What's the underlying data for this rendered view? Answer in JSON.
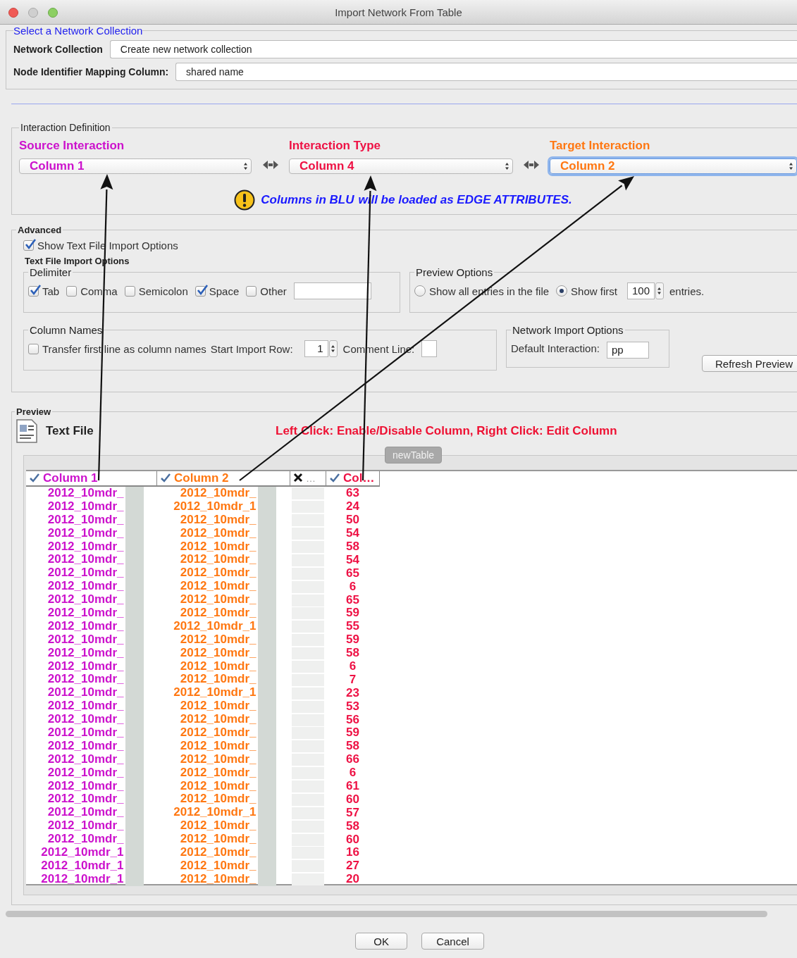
{
  "window": {
    "title": "Import Network From Table"
  },
  "network_collection": {
    "legend": "Select a Network Collection",
    "fields": [
      {
        "label": "Network Collection",
        "value": "Create new network collection"
      },
      {
        "label": "Node Identifier Mapping Column:",
        "value": "shared name"
      }
    ]
  },
  "interaction_definition": {
    "legend": "Interaction Definition",
    "selectors": [
      {
        "label": "Source Interaction",
        "value": "Column 1",
        "color": "#cc11cc",
        "focused": false
      },
      {
        "label": "Interaction Type",
        "value": "Column 4",
        "color": "#ee1144",
        "focused": false
      },
      {
        "label": "Target Interaction",
        "value": "Column 2",
        "color": "#ff7711",
        "focused": true
      }
    ],
    "notice": [
      "Columns in BLU",
      "will be loaded as EDGE ATTRIBUTES."
    ]
  },
  "advanced": {
    "legend": "Advanced",
    "show_options": {
      "label": "Show Text File Import Options",
      "checked": true
    },
    "options_title": "Text File Import Options",
    "delimiter": {
      "legend": "Delimiter",
      "items": [
        {
          "label": "Tab",
          "checked": true
        },
        {
          "label": "Comma",
          "checked": false
        },
        {
          "label": "Semicolon",
          "checked": false
        },
        {
          "label": "Space",
          "checked": true
        },
        {
          "label": "Other",
          "checked": false
        }
      ]
    },
    "preview_options": {
      "legend": "Preview Options",
      "choices": [
        {
          "label": "Show all entries in the file",
          "selected": false
        },
        {
          "label": "Show first",
          "selected": true
        }
      ],
      "count": "100",
      "suffix": "entries."
    },
    "column_names": {
      "legend": "Column Names",
      "transfer": {
        "label": "Transfer first line as column names",
        "checked": false
      },
      "start_row_label": "Start Import Row:",
      "start_row": "1",
      "comment_label": "Comment Line:"
    },
    "network_import": {
      "legend": "Network Import Options",
      "default_label": "Default Interaction:",
      "default_value": "pp"
    },
    "refresh_button": "Refresh Preview"
  },
  "preview": {
    "legend": "Preview",
    "file_label": "Text File",
    "hint": "Left Click: Enable/Disable Column, Right Click: Edit Column",
    "tab": "newTable",
    "columns": [
      {
        "label": "Column 1",
        "enabled": true,
        "color": "#cc11cc"
      },
      {
        "label": "Column 2",
        "enabled": true,
        "color": "#ff7711"
      },
      {
        "label": "…",
        "enabled": false
      },
      {
        "label": "Col…",
        "enabled": true,
        "color": "#ee1144"
      }
    ],
    "rows": [
      {
        "column_1": "2012_10mdr_",
        "column_2": "2012_10mdr_",
        "column_4": "63"
      },
      {
        "column_1": "2012_10mdr_",
        "column_2": "2012_10mdr_1",
        "column_4": "24"
      },
      {
        "column_1": "2012_10mdr_",
        "column_2": "2012_10mdr_",
        "column_4": "50"
      },
      {
        "column_1": "2012_10mdr_",
        "column_2": "2012_10mdr_",
        "column_4": "54"
      },
      {
        "column_1": "2012_10mdr_",
        "column_2": "2012_10mdr_",
        "column_4": "58"
      },
      {
        "column_1": "2012_10mdr_",
        "column_2": "2012_10mdr_",
        "column_4": "54"
      },
      {
        "column_1": "2012_10mdr_",
        "column_2": "2012_10mdr_",
        "column_4": "65"
      },
      {
        "column_1": "2012_10mdr_",
        "column_2": "2012_10mdr_",
        "column_4": "6"
      },
      {
        "column_1": "2012_10mdr_",
        "column_2": "2012_10mdr_",
        "column_4": "65"
      },
      {
        "column_1": "2012_10mdr_",
        "column_2": "2012_10mdr_",
        "column_4": "59"
      },
      {
        "column_1": "2012_10mdr_",
        "column_2": "2012_10mdr_1",
        "column_4": "55"
      },
      {
        "column_1": "2012_10mdr_",
        "column_2": "2012_10mdr_",
        "column_4": "59"
      },
      {
        "column_1": "2012_10mdr_",
        "column_2": "2012_10mdr_",
        "column_4": "58"
      },
      {
        "column_1": "2012_10mdr_",
        "column_2": "2012_10mdr_",
        "column_4": "6"
      },
      {
        "column_1": "2012_10mdr_",
        "column_2": "2012_10mdr_",
        "column_4": "7"
      },
      {
        "column_1": "2012_10mdr_",
        "column_2": "2012_10mdr_1",
        "column_4": "23"
      },
      {
        "column_1": "2012_10mdr_",
        "column_2": "2012_10mdr_",
        "column_4": "53"
      },
      {
        "column_1": "2012_10mdr_",
        "column_2": "2012_10mdr_",
        "column_4": "56"
      },
      {
        "column_1": "2012_10mdr_",
        "column_2": "2012_10mdr_",
        "column_4": "59"
      },
      {
        "column_1": "2012_10mdr_",
        "column_2": "2012_10mdr_",
        "column_4": "58"
      },
      {
        "column_1": "2012_10mdr_",
        "column_2": "2012_10mdr_",
        "column_4": "66"
      },
      {
        "column_1": "2012_10mdr_",
        "column_2": "2012_10mdr_",
        "column_4": "6"
      },
      {
        "column_1": "2012_10mdr_",
        "column_2": "2012_10mdr_",
        "column_4": "61"
      },
      {
        "column_1": "2012_10mdr_",
        "column_2": "2012_10mdr_",
        "column_4": "60"
      },
      {
        "column_1": "2012_10mdr_",
        "column_2": "2012_10mdr_1",
        "column_4": "57"
      },
      {
        "column_1": "2012_10mdr_",
        "column_2": "2012_10mdr_",
        "column_4": "58"
      },
      {
        "column_1": "2012_10mdr_",
        "column_2": "2012_10mdr_",
        "column_4": "60"
      },
      {
        "column_1": "2012_10mdr_1",
        "column_2": "2012_10mdr_",
        "column_4": "16"
      },
      {
        "column_1": "2012_10mdr_1",
        "column_2": "2012_10mdr_",
        "column_4": "27"
      },
      {
        "column_1": "2012_10mdr_1",
        "column_2": "2012_10mdr_",
        "column_4": "20"
      }
    ]
  },
  "buttons": [
    "OK",
    "Cancel"
  ]
}
